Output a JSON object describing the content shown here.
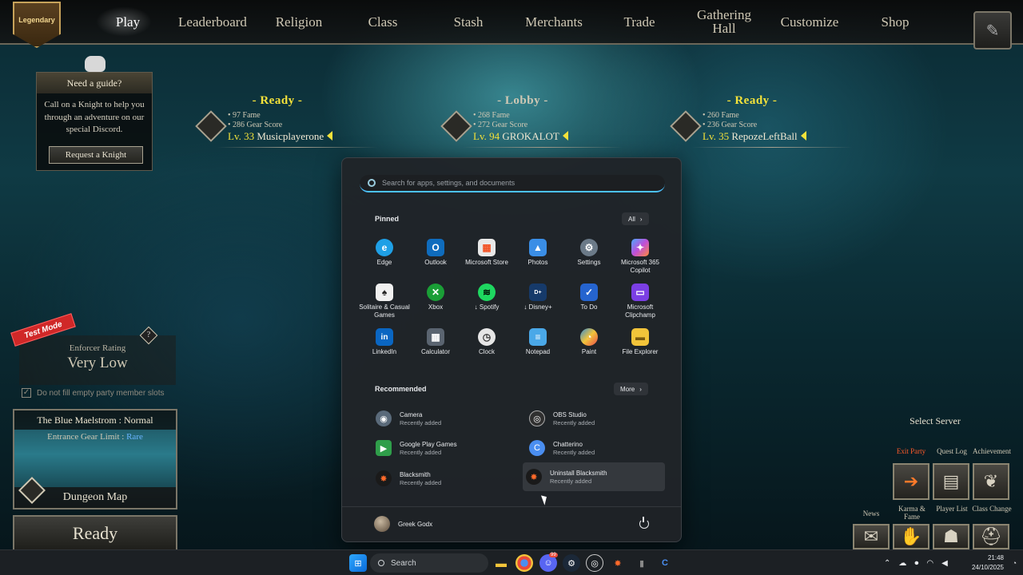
{
  "game": {
    "badge": "Legendary",
    "nav": [
      "Play",
      "Leaderboard",
      "Religion",
      "Class",
      "Stash",
      "Merchants",
      "Trade",
      "Gathering Hall",
      "Customize",
      "Shop"
    ],
    "active_nav": "Play",
    "guide": {
      "title": "Need a guide?",
      "body": "Call on a Knight to help you through an adventure on our special Discord.",
      "button": "Request a Knight"
    },
    "party": [
      {
        "status": "- Ready -",
        "fame": "97 Fame",
        "gear": "286 Gear Score",
        "level": "Lv. 33",
        "name": "Musicplayerone"
      },
      {
        "status": "- Lobby -",
        "fame": "268 Fame",
        "gear": "272 Gear Score",
        "level": "Lv. 94",
        "name": "GROKALOT"
      },
      {
        "status": "- Ready -",
        "fame": "260 Fame",
        "gear": "236 Gear Score",
        "level": "Lv. 35",
        "name": "RepozeLeftBall"
      }
    ],
    "test_mode": "Test Mode",
    "enforcer": {
      "label": "Enforcer Rating",
      "value": "Very Low",
      "help": "?"
    },
    "fill_slots": {
      "label": "Do not fill empty party member slots",
      "checked": true
    },
    "dungeon": {
      "title": "The Blue Maelstrom : Normal",
      "limit_label": "Entrance Gear Limit :",
      "limit_value": "Rare",
      "map_label": "Dungeon Map"
    },
    "ready_button": "Ready",
    "select_server": "Select Server",
    "tabs": {
      "exit_party": "Exit Party",
      "quest_log": "Quest Log",
      "achievement": "Achievement"
    },
    "bottom_buttons": {
      "player_list": "Player List",
      "class_change": "Class Change",
      "news": "News",
      "karma": "Karma & Fame"
    }
  },
  "start_menu": {
    "search_placeholder": "Search for apps, settings, and documents",
    "pinned_title": "Pinned",
    "all_button": "All",
    "pinned": [
      {
        "label": "Edge",
        "icon": "edge-icon",
        "color": "#1fa0e6"
      },
      {
        "label": "Outlook",
        "icon": "outlook-icon",
        "color": "#0f6cbd"
      },
      {
        "label": "Microsoft Store",
        "icon": "store-icon",
        "color": "#e8e8e8"
      },
      {
        "label": "Photos",
        "icon": "photos-icon",
        "color": "#3a8ee6"
      },
      {
        "label": "Settings",
        "icon": "gear-icon",
        "color": "#6b7a88"
      },
      {
        "label": "Microsoft 365 Copilot",
        "icon": "copilot-icon",
        "color": "#c04fd8"
      },
      {
        "label": "Solitaire & Casual Games",
        "icon": "cards-icon",
        "color": "#f0f0f0"
      },
      {
        "label": "Xbox",
        "icon": "xbox-icon",
        "color": "#1a9e36"
      },
      {
        "label": "↓ Spotify",
        "icon": "spotify-icon",
        "color": "#1ed760"
      },
      {
        "label": "↓ Disney+",
        "icon": "disney-icon",
        "color": "#163a6a"
      },
      {
        "label": "To Do",
        "icon": "todo-icon",
        "color": "#2564cf"
      },
      {
        "label": "Microsoft Clipchamp",
        "icon": "clipchamp-icon",
        "color": "#7b3fe4"
      },
      {
        "label": "LinkedIn",
        "icon": "linkedin-icon",
        "color": "#0a66c2"
      },
      {
        "label": "Calculator",
        "icon": "calculator-icon",
        "color": "#5a6470"
      },
      {
        "label": "Clock",
        "icon": "clock-icon",
        "color": "#e6e6e6"
      },
      {
        "label": "Notepad",
        "icon": "notepad-icon",
        "color": "#4aa8e8"
      },
      {
        "label": "Paint",
        "icon": "paint-icon",
        "color": "#2e8bd8"
      },
      {
        "label": "File Explorer",
        "icon": "folder-icon",
        "color": "#f2c43a"
      }
    ],
    "recommended_title": "Recommended",
    "more_button": "More",
    "recommended": [
      {
        "name": "Camera",
        "sub": "Recently added",
        "icon": "camera-icon",
        "color": "#5a6a7a"
      },
      {
        "name": "OBS Studio",
        "sub": "Recently added",
        "icon": "obs-icon",
        "color": "#303030"
      },
      {
        "name": "Google Play Games",
        "sub": "Recently added",
        "icon": "playgames-icon",
        "color": "#2f9e4a"
      },
      {
        "name": "Chatterino",
        "sub": "Recently added",
        "icon": "chatterino-icon",
        "color": "#4a8ef0"
      },
      {
        "name": "Blacksmith",
        "sub": "Recently added",
        "icon": "blacksmith-icon",
        "color": "#c64a1e"
      },
      {
        "name": "Uninstall Blacksmith",
        "sub": "Recently added",
        "icon": "blacksmith-icon",
        "color": "#c64a1e"
      }
    ],
    "user": "Greek Godx"
  },
  "taskbar": {
    "search_label": "Search",
    "time": "21:48",
    "date": "24/10/2025",
    "discord_badge": "99"
  }
}
